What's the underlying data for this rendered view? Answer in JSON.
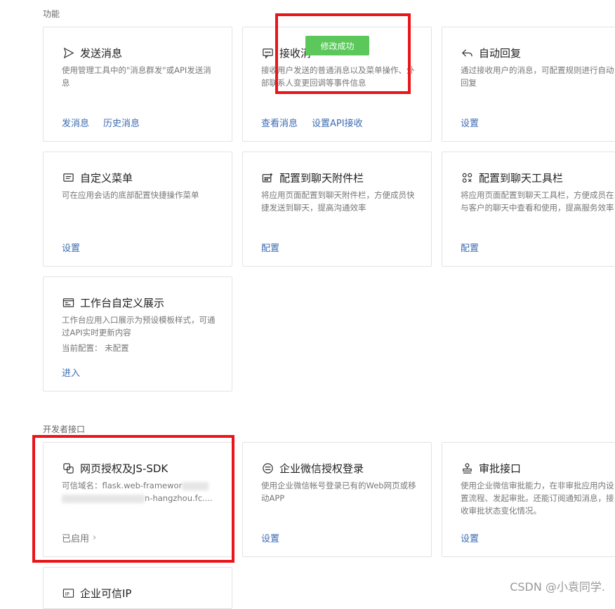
{
  "sections": {
    "functions": "功能",
    "developer": "开发者接口"
  },
  "cards": {
    "send_message": {
      "title": "发送消息",
      "desc": "使用管理工具中的\"消息群发\"或API发送消息",
      "links": [
        "发消息",
        "历史消息"
      ]
    },
    "receive_message": {
      "title": "接收消",
      "desc": "接收用户发送的普通消息以及菜单操作、外部联系人变更回调等事件信息",
      "links": [
        "查看消息",
        "设置API接收"
      ]
    },
    "auto_reply": {
      "title": "自动回复",
      "desc": "通过接收用户的消息，可配置规则进行自动回复",
      "links": [
        "设置"
      ]
    },
    "custom_menu": {
      "title": "自定义菜单",
      "desc": "可在应用会话的底部配置快捷操作菜单",
      "links": [
        "设置"
      ]
    },
    "chat_attachment": {
      "title": "配置到聊天附件栏",
      "desc": "将应用页面配置到聊天附件栏，方便成员快捷发送到聊天，提高沟通效率",
      "links": [
        "配置"
      ]
    },
    "chat_toolbar": {
      "title": "配置到聊天工具栏",
      "desc": "将应用页面配置到聊天工具栏，方便成员在与客户的聊天中查看和使用，提高服务效率",
      "links": [
        "配置"
      ]
    },
    "workbench": {
      "title": "工作台自定义展示",
      "desc": "工作台应用入口展示为预设模板样式，可通过API实时更新内容",
      "config": "当前配置：  未配置",
      "links": [
        "进入"
      ]
    },
    "web_auth": {
      "title": "网页授权及JS-SDK",
      "desc_line1": "可信域名：flask.web-framewor",
      "desc_line2": "n-hangzhou.fc....",
      "status": "已启用"
    },
    "wecom_login": {
      "title": "企业微信授权登录",
      "desc": "使用企业微信帐号登录已有的Web网页或移动APP",
      "links": [
        "设置"
      ]
    },
    "approval": {
      "title": "审批接口",
      "desc": "使用企业微信审批能力，在非审批应用内设置流程、发起审批。还能订阅通知消息，接收审批状态变化情况。",
      "links": [
        "设置"
      ]
    },
    "trusted_ip": {
      "title": "企业可信IP"
    }
  },
  "toast": "修改成功",
  "watermark": "CSDN @小袁同学."
}
